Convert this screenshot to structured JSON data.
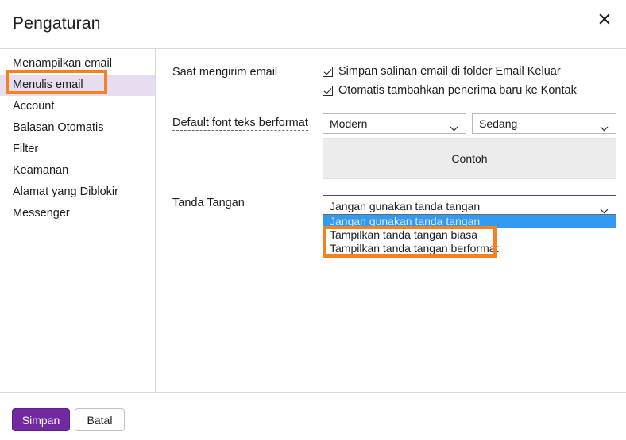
{
  "window": {
    "title": "Pengaturan",
    "close_icon": "close-icon"
  },
  "sidebar": {
    "items": [
      {
        "label": "Menampilkan email",
        "selected": false
      },
      {
        "label": "Menulis email",
        "selected": true
      },
      {
        "label": "Account",
        "selected": false
      },
      {
        "label": "Balasan Otomatis",
        "selected": false
      },
      {
        "label": "Filter",
        "selected": false
      },
      {
        "label": "Keamanan",
        "selected": false
      },
      {
        "label": "Alamat yang Diblokir",
        "selected": false
      },
      {
        "label": "Messenger",
        "selected": false
      }
    ]
  },
  "main": {
    "send_section": {
      "label": "Saat mengirim email",
      "checkboxes": [
        {
          "label": "Simpan salinan email di folder Email Keluar",
          "checked": true
        },
        {
          "label": "Otomatis tambahkan penerima baru ke Kontak",
          "checked": true
        }
      ]
    },
    "font_section": {
      "label": "Default font teks berformat",
      "font_select": {
        "value": "Modern",
        "options": [
          "Modern"
        ]
      },
      "size_select": {
        "value": "Sedang",
        "options": [
          "Sedang"
        ]
      },
      "preview_text": "Contoh"
    },
    "signature_section": {
      "label": "Tanda Tangan",
      "select": {
        "value": "Jangan gunakan tanda tangan",
        "expanded": true,
        "options": [
          {
            "label": "Jangan gunakan tanda tangan",
            "highlighted": true
          },
          {
            "label": "Tampilkan tanda tangan biasa",
            "highlighted": false
          },
          {
            "label": "Tampilkan tanda tangan berformat",
            "highlighted": false
          }
        ]
      }
    }
  },
  "footer": {
    "save_label": "Simpan",
    "cancel_label": "Batal"
  },
  "colors": {
    "accent_purple": "#7228a0",
    "selected_row": "#e7dcf0",
    "highlight_blue": "#3399f3",
    "annotation_orange": "#f58220",
    "preview_grey": "#ececec"
  }
}
